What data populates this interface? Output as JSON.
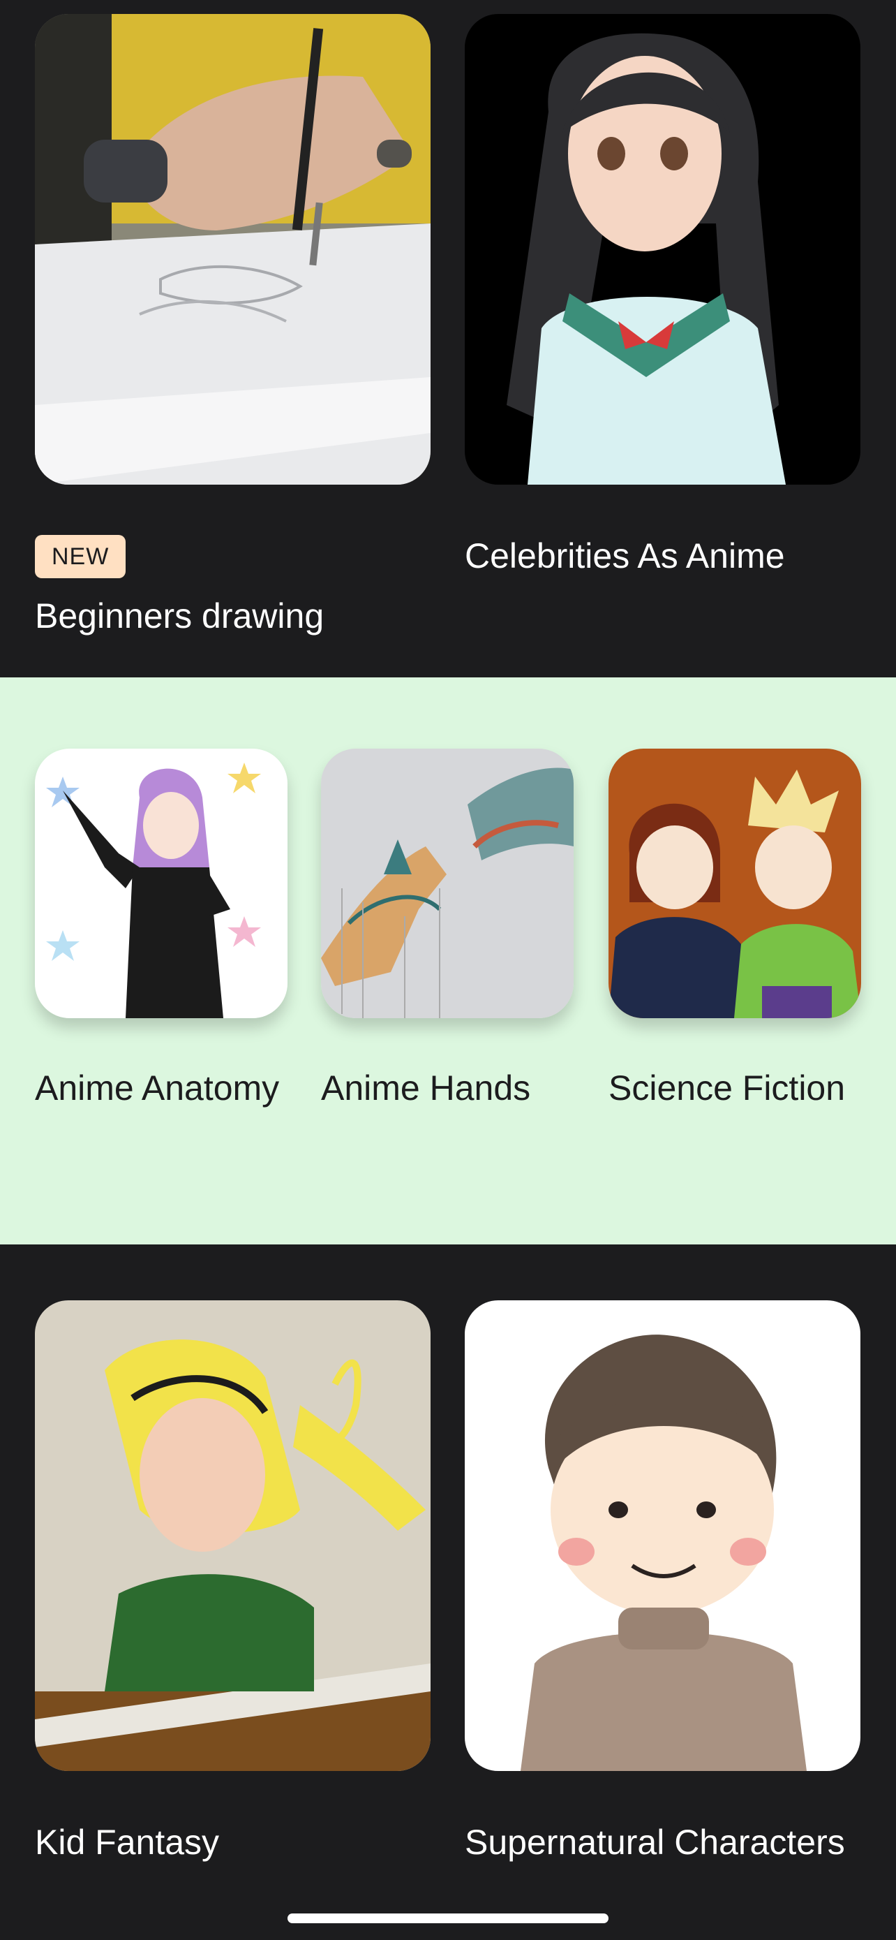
{
  "featured": [
    {
      "badge": "NEW",
      "title": "Beginners drawing"
    },
    {
      "title": "Celebrities As Anime"
    }
  ],
  "categories": [
    {
      "title": "Anime Anatomy"
    },
    {
      "title": "Anime Hands"
    },
    {
      "title": "Science Fiction"
    }
  ],
  "more": [
    {
      "title": "Kid Fantasy"
    },
    {
      "title": "Supernatural Characters"
    }
  ],
  "colors": {
    "background_dark": "#1c1c1e",
    "section_green": "#dcf7df",
    "badge_bg": "#ffe0c2"
  }
}
